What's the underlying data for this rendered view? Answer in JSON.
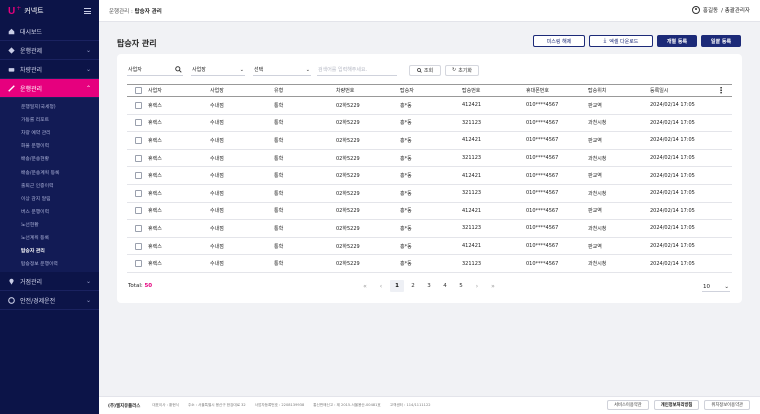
{
  "brand": {
    "logo_mark": "U",
    "logo_plus": "+",
    "logo_text": "커넥트"
  },
  "sidebar": {
    "items": [
      {
        "label": "대시보드",
        "icon": "home-icon",
        "chevron": ""
      },
      {
        "label": "운행관제",
        "icon": "monitor-icon",
        "chevron": "⌄"
      },
      {
        "label": "차량관리",
        "icon": "car-icon",
        "chevron": "⌄"
      },
      {
        "label": "운행관리",
        "icon": "route-icon",
        "chevron": "⌃"
      },
      {
        "label": "거점관리",
        "icon": "pin-icon",
        "chevron": "⌄"
      },
      {
        "label": "안전/경제운전",
        "icon": "shield-icon",
        "chevron": "⌄"
      }
    ],
    "submenu": [
      "운행일지(국세청)",
      "가동률 리포트",
      "차량 예약 관리",
      "화물 운행이력",
      "배송/운송현황",
      "배송/운송계획 등록",
      "출퇴근 인증이력",
      "이상 감지 알림",
      "버스 운행이력",
      "노선현황",
      "노선계획 등록",
      "탑승자 관리",
      "탑승정보 운행이력"
    ],
    "current_sub": "탑승자 관리"
  },
  "header": {
    "breadcrumb_prefix": "운행관리 : ",
    "breadcrumb_current": "탑승자 관리",
    "user_name": "홍길동",
    "user_role": "/ 총괄관리자"
  },
  "page": {
    "title": "탑승자 관리",
    "actions": {
      "unlink": "미스링 해제",
      "excel": "엑셀 다운로드",
      "single": "개별 등록",
      "bulk": "일괄 등록"
    }
  },
  "filters": {
    "company": "사업자",
    "site": "사업장",
    "select": "선택",
    "search_placeholder": "검색어를 입력해주세요.",
    "search_btn": "조회",
    "reset_btn": "초기화"
  },
  "table": {
    "columns": [
      "사업자",
      "사업장",
      "유형",
      "차량번호",
      "탑승자",
      "탑승번호",
      "휴대폰번호",
      "탑승위치",
      "등록일시"
    ],
    "rows": [
      [
        "휴렉스",
        "수내점",
        "통학",
        "02하5229",
        "홍*동",
        "412421",
        "010****4567",
        "판교역",
        "2024/02/14 17:05"
      ],
      [
        "휴렉스",
        "수내점",
        "통학",
        "02하5229",
        "홍*동",
        "321123",
        "010****4567",
        "과천시청",
        "2024/02/14 17:05"
      ],
      [
        "휴렉스",
        "수내점",
        "통학",
        "02하5229",
        "홍*동",
        "412421",
        "010****4567",
        "판교역",
        "2024/02/14 17:05"
      ],
      [
        "휴렉스",
        "수내점",
        "통학",
        "02하5229",
        "홍*동",
        "321123",
        "010****4567",
        "과천시청",
        "2024/02/14 17:05"
      ],
      [
        "휴렉스",
        "수내점",
        "통학",
        "02하5229",
        "홍*동",
        "412421",
        "010****4567",
        "판교역",
        "2024/02/14 17:05"
      ],
      [
        "휴렉스",
        "수내점",
        "통학",
        "02하5229",
        "홍*동",
        "321123",
        "010****4567",
        "과천시청",
        "2024/02/14 17:05"
      ],
      [
        "휴렉스",
        "수내점",
        "통학",
        "02하5229",
        "홍*동",
        "412421",
        "010****4567",
        "판교역",
        "2024/02/14 17:05"
      ],
      [
        "휴렉스",
        "수내점",
        "통학",
        "02하5229",
        "홍*동",
        "321123",
        "010****4567",
        "과천시청",
        "2024/02/14 17:05"
      ],
      [
        "휴렉스",
        "수내점",
        "통학",
        "02하5229",
        "홍*동",
        "412421",
        "010****4567",
        "판교역",
        "2024/02/14 17:05"
      ],
      [
        "휴렉스",
        "수내점",
        "통학",
        "02하5229",
        "홍*동",
        "321123",
        "010****4567",
        "과천시청",
        "2024/02/14 17:05"
      ]
    ]
  },
  "summary": {
    "total_label": "Total: ",
    "total_value": "50"
  },
  "pagination": {
    "first": "«",
    "prev": "‹",
    "pages": [
      "1",
      "2",
      "3",
      "4",
      "5"
    ],
    "next": "›",
    "last": "»",
    "current": "1",
    "page_size": "10"
  },
  "footer": {
    "company": "(주)엘지유플러스",
    "ceo": "대표이사 : 황현식",
    "address": "주소 : 서울특별시 용산구 한강대로 32",
    "biz_no": "사업자등록번호 : 2208139938",
    "telecom": "통신판매신고 : 제 2015-서울용산-00481호",
    "support": "고객센터 : 114/1111122",
    "links": [
      "서비스이용약관",
      "개인정보처리방침",
      "위치정보이용약관"
    ]
  },
  "colors": {
    "sidebar_bg": "#0c1448",
    "accent": "#e6007e",
    "primary": "#1c2a78"
  }
}
